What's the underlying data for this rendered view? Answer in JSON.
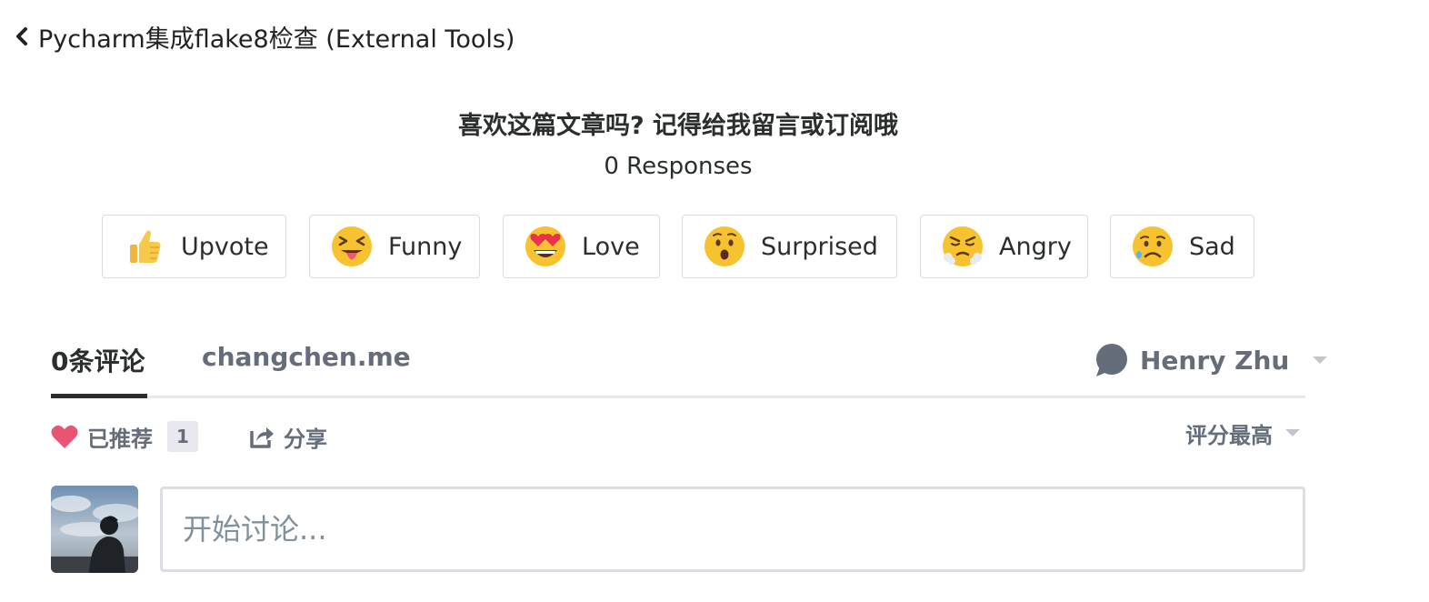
{
  "back_link": {
    "label": "Pycharm集成flake8检查 (External Tools)"
  },
  "reactions": {
    "title": "喜欢这篇文章吗? 记得给我留言或订阅哦",
    "responses_count": "0 Responses",
    "items": [
      {
        "label": "Upvote",
        "icon": "thumbs-up-emoji"
      },
      {
        "label": "Funny",
        "icon": "squinting-tongue-emoji"
      },
      {
        "label": "Love",
        "icon": "heart-eyes-emoji"
      },
      {
        "label": "Surprised",
        "icon": "hushed-face-emoji"
      },
      {
        "label": "Angry",
        "icon": "steaming-face-emoji"
      },
      {
        "label": "Sad",
        "icon": "sad-sweat-face-emoji"
      }
    ]
  },
  "tabs": {
    "comments_label": "0条评论",
    "site_label": "changchen.me",
    "user_name": "Henry Zhu"
  },
  "actions": {
    "recommend_label": "已推荐",
    "recommend_count": "1",
    "share_label": "分享",
    "sort_label": "评分最高"
  },
  "composer": {
    "placeholder": "开始讨论..."
  },
  "colors": {
    "text_dark": "#2a2e2e",
    "text_muted": "#656c7a",
    "heart_red": "#e95473",
    "border": "#d9dcde",
    "emoji_yellow": "#f7c230"
  }
}
